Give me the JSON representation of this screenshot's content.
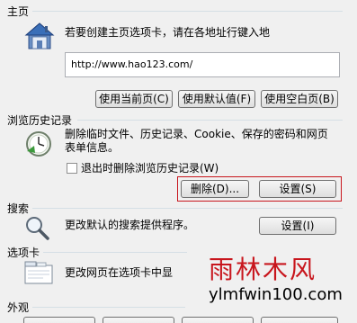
{
  "home": {
    "title": "主页",
    "description": "若要创建主页选项卡，请在各地址行键入地",
    "url": "http://www.hao123.com/",
    "buttons": {
      "use_current": "使用当前页(C)",
      "use_default": "使用默认值(F)",
      "use_blank": "使用空白页(B)"
    }
  },
  "history": {
    "title": "浏览历史记录",
    "description_line1": "删除临时文件、历史记录、Cookie、保存的密码和网页",
    "description_line2": "表单信息。",
    "checkbox_label": "退出时删除浏览历史记录(W)",
    "checkbox_checked": false,
    "delete_button": "删除(D)...",
    "settings_button": "设置(S)"
  },
  "search": {
    "title": "搜索",
    "description": "更改默认的搜索提供程序。",
    "settings_button": "设置(I)"
  },
  "tabs": {
    "title": "选项卡",
    "description": "更改网页在选项卡中显"
  },
  "appearance": {
    "title": "外观"
  },
  "watermark": {
    "cn": "雨林木风",
    "en": "ylmfwin100.com"
  },
  "colors": {
    "highlight": "#c8161d",
    "section_line": "#d5dfe5"
  }
}
